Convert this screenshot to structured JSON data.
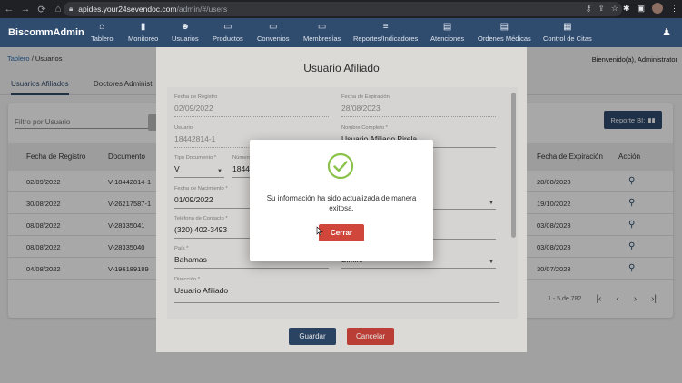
{
  "browser": {
    "nav_icons": [
      "←",
      "→",
      "⟳",
      "⌂"
    ],
    "url_host": "apides.your24sevendoc.com",
    "url_path": "/admin/#/users",
    "url_icons": [
      "⚷",
      "⇪",
      "☆"
    ],
    "ext_icons": [
      "✱",
      "▣"
    ],
    "menu_icon": "⋮"
  },
  "header": {
    "brand": "BiscommAdmin",
    "nav": [
      {
        "label": "Tablero",
        "icon": "⌂"
      },
      {
        "label": "Monitoreo",
        "icon": "▮"
      },
      {
        "label": "Usuarios",
        "icon": "☻"
      },
      {
        "label": "Productos",
        "icon": "▭"
      },
      {
        "label": "Convenios",
        "icon": "▭"
      },
      {
        "label": "Membresías",
        "icon": "▭"
      },
      {
        "label": "Reportes/Indicadores",
        "icon": "≡"
      },
      {
        "label": "Atenciones",
        "icon": "▤"
      },
      {
        "label": "Ordenes Médicas",
        "icon": "▤"
      },
      {
        "label": "Control de Citas",
        "icon": "▦"
      }
    ],
    "user_icon": "♟"
  },
  "page": {
    "breadcrumb_link": "Tablero",
    "breadcrumb_sep": " / ",
    "breadcrumb_current": "Usuarios",
    "welcome": "Bienvenido(a), Administrator",
    "tabs": [
      "Usuarios Afiliados",
      "Doctores Administ"
    ],
    "filter_placeholder": "Filtro por Usuario",
    "report_button": "Reporte BI:",
    "columns": [
      "Fecha de Registro",
      "Documento",
      "Fecha de Expiración",
      "Acción"
    ],
    "rows": [
      {
        "fecha": "02/09/2022",
        "doc": "V-18442814-1",
        "exp": "28/08/2023"
      },
      {
        "fecha": "30/08/2022",
        "doc": "V-26217587-1",
        "exp": "19/10/2022"
      },
      {
        "fecha": "08/08/2022",
        "doc": "V-28335041",
        "exp": "03/08/2023"
      },
      {
        "fecha": "08/08/2022",
        "doc": "V-28335040",
        "exp": "03/08/2023"
      },
      {
        "fecha": "04/08/2022",
        "doc": "V-196189189",
        "exp": "30/07/2023"
      }
    ],
    "pagination": "1 - 5 de 782",
    "pagination_icons": [
      "|‹",
      "‹",
      "›",
      "›|"
    ]
  },
  "dialog": {
    "title": "Usuario Afiliado",
    "fields": {
      "fecha_registro": {
        "label": "Fecha de Registro",
        "value": "02/09/2022"
      },
      "fecha_expiracion": {
        "label": "Fecha de Expiración",
        "value": "28/08/2023"
      },
      "usuario": {
        "label": "Usuario",
        "value": "18442814-1"
      },
      "nombre": {
        "label": "Nombre Completo *",
        "value": "Usuario Afiliado Pirela"
      },
      "tipo_doc": {
        "label": "Tipo Documento *",
        "value": "V"
      },
      "numero": {
        "label": "Número",
        "value": "1844"
      },
      "nacimiento": {
        "label": "Fecha de Nacimiento *",
        "value": "01/09/2022"
      },
      "telefono": {
        "label": "Teléfono de Contacto *",
        "value": "(320) 402-3493"
      },
      "pais": {
        "label": "País *",
        "value": "Bahamas"
      },
      "ciudad": {
        "label": "Ciudad *",
        "value": "Bimini"
      },
      "direccion": {
        "label": "Dirección *",
        "value": "Usuario Afiliado"
      }
    },
    "save_label": "Guardar",
    "cancel_label": "Cancelar"
  },
  "success_modal": {
    "message": "Su información ha sido actualizada de manera exitosa.",
    "close_label": "Cerrar",
    "icon": "check-circle-icon"
  },
  "colors": {
    "header": "#2f4b6e",
    "danger": "#d0463b",
    "success": "#8bc34a"
  }
}
